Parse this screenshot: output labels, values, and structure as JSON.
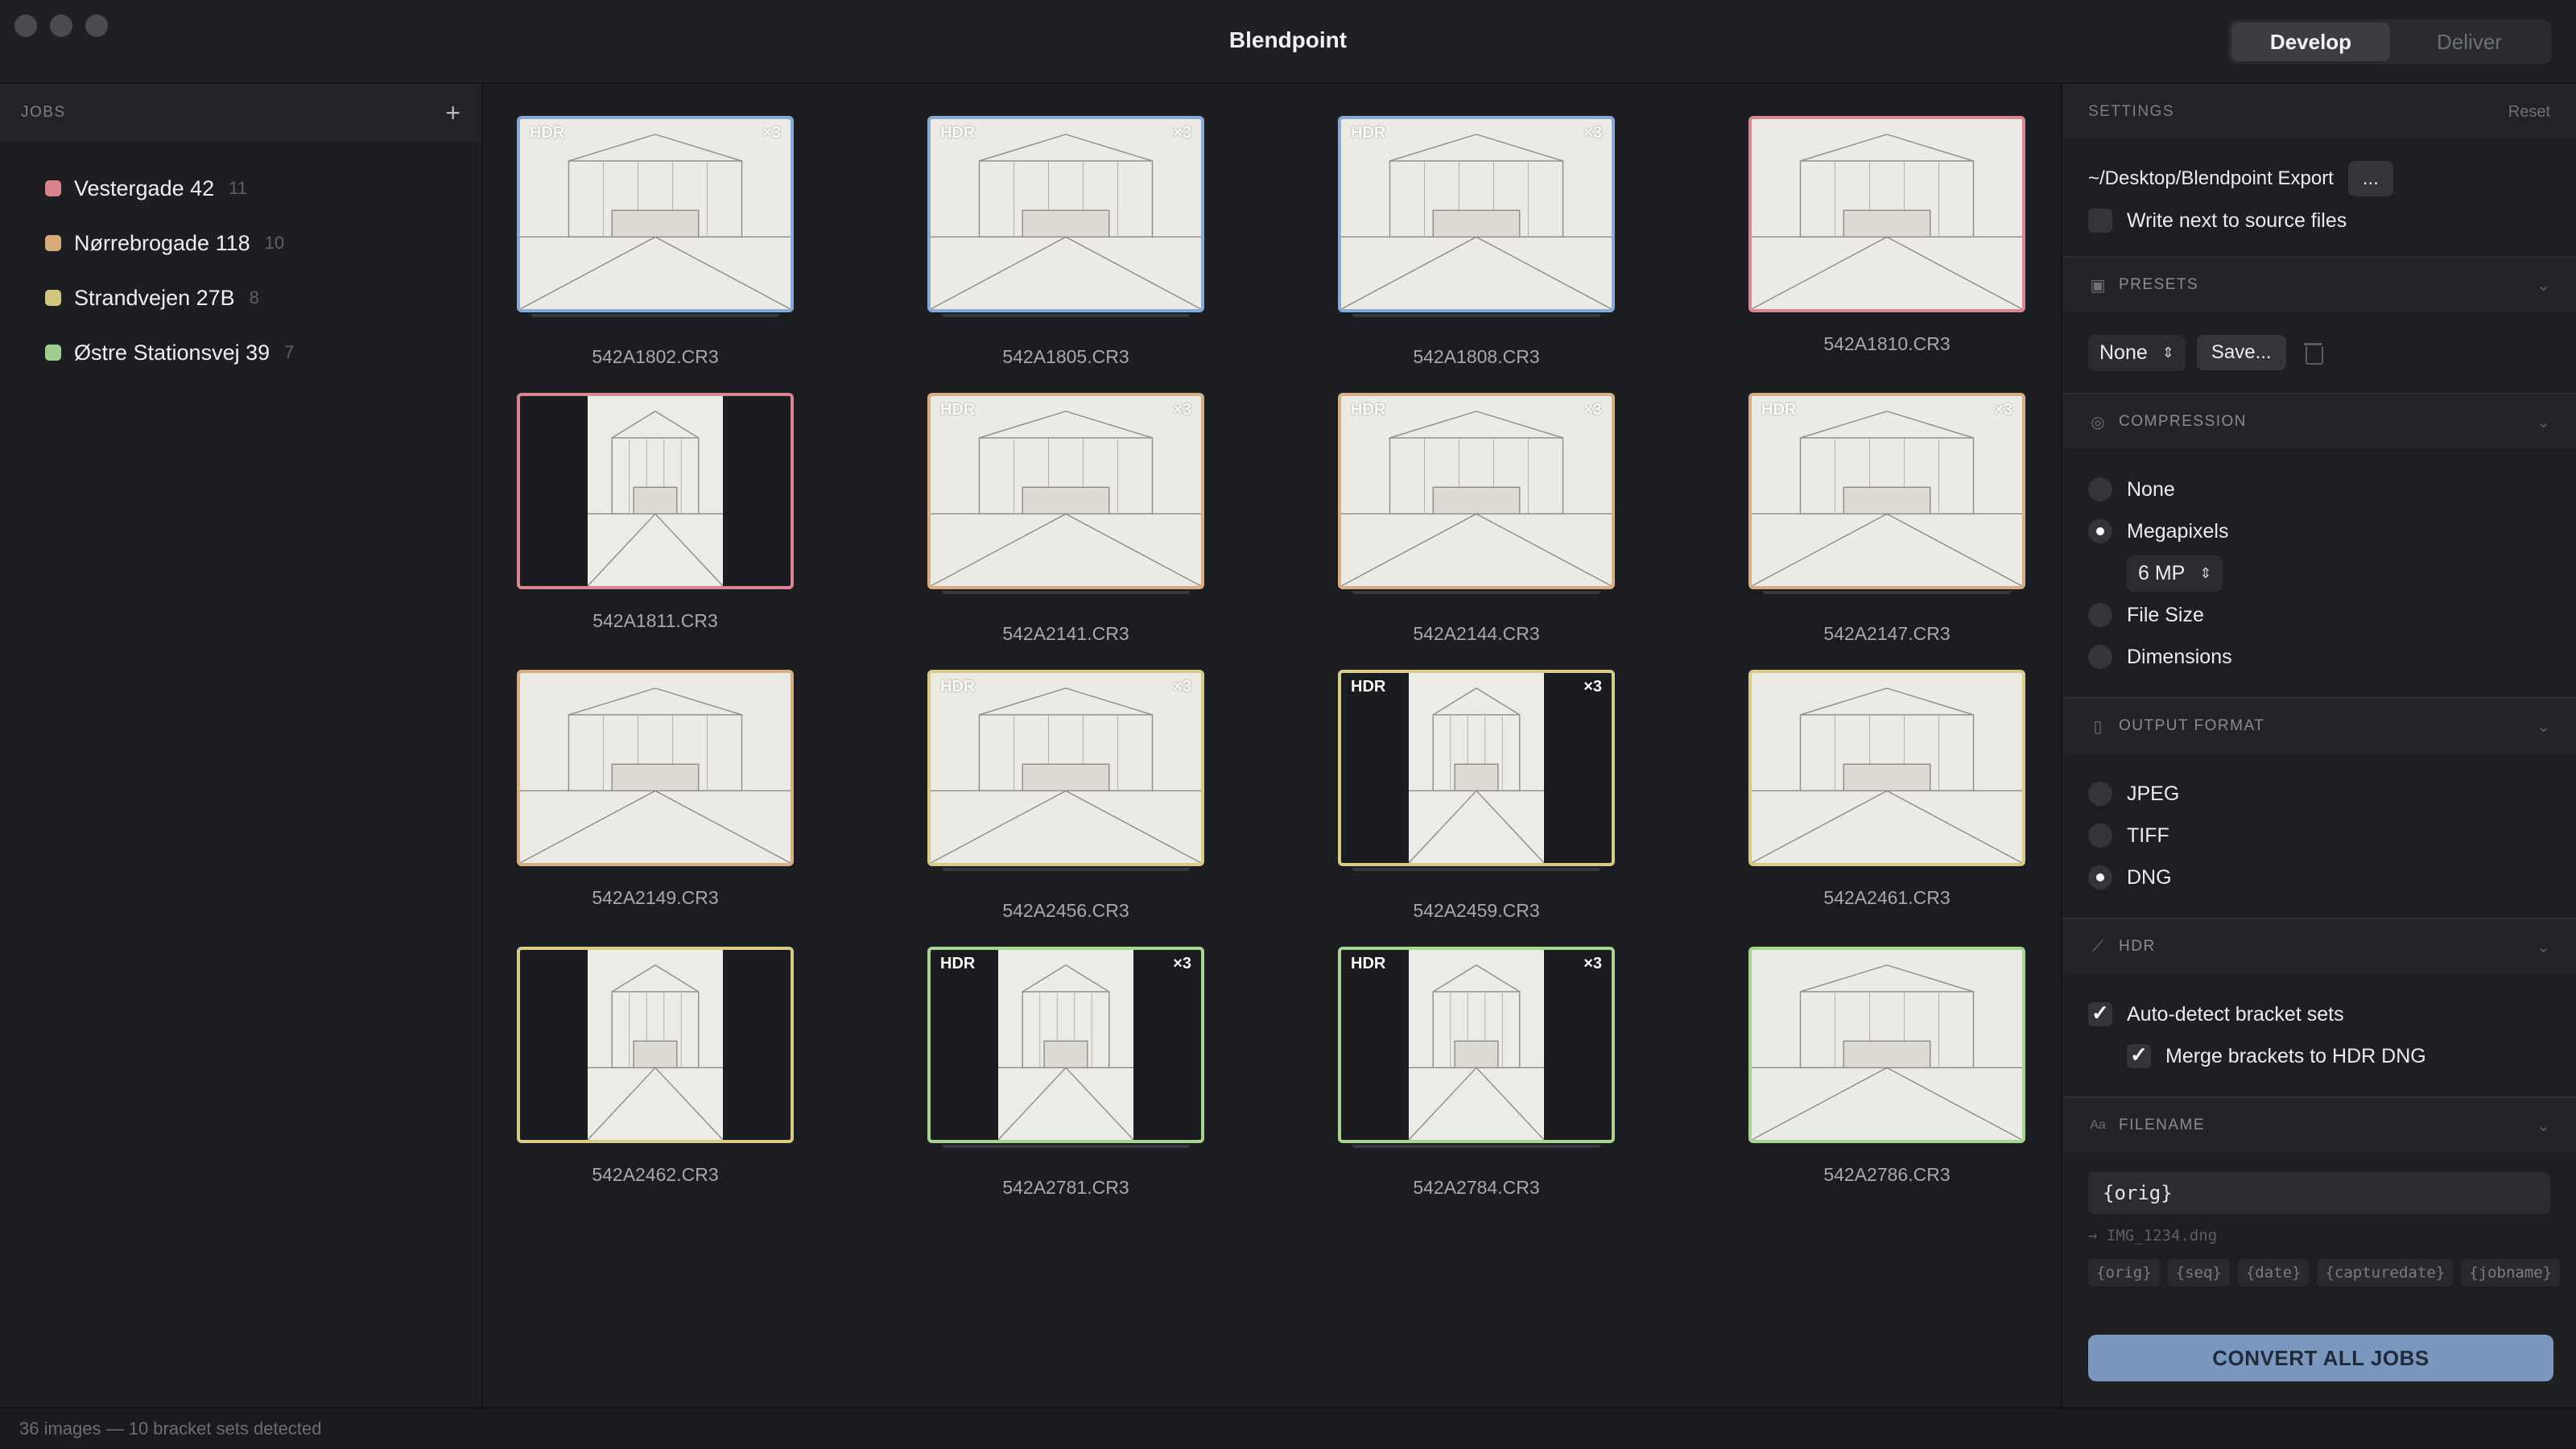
{
  "window": {
    "title": "Blendpoint",
    "modes": [
      {
        "label": "Develop",
        "active": true
      },
      {
        "label": "Deliver",
        "active": false
      }
    ]
  },
  "sidebar": {
    "header": "JOBS",
    "add_icon": "plus-icon",
    "jobs": [
      {
        "name": "Vestergade 42",
        "count": "11",
        "color": "#d9838b"
      },
      {
        "name": "Nørrebrogade 118",
        "count": "10",
        "color": "#d7a979"
      },
      {
        "name": "Strandvejen 27B",
        "count": "8",
        "color": "#d2c77f"
      },
      {
        "name": "Østre Stationsvej 39",
        "count": "7",
        "color": "#9fcf8e"
      }
    ]
  },
  "grid": {
    "tiles": [
      {
        "file": "542A1802.CR3",
        "hdr": "HDR",
        "count": "×3",
        "frame": "#86a9d8",
        "portrait": false,
        "stacked": true,
        "subject": "kitchen"
      },
      {
        "file": "542A1805.CR3",
        "hdr": "HDR",
        "count": "×3",
        "frame": "#86a9d8",
        "portrait": false,
        "stacked": true,
        "subject": "living-room"
      },
      {
        "file": "542A1808.CR3",
        "hdr": "HDR",
        "count": "×3",
        "frame": "#86a9d8",
        "portrait": false,
        "stacked": true,
        "subject": "staircase"
      },
      {
        "file": "542A1810.CR3",
        "frame": "#d98891",
        "portrait": false,
        "stacked": false,
        "subject": "pool-house"
      },
      {
        "file": "542A1811.CR3",
        "frame": "#d98891",
        "portrait": true,
        "stacked": false,
        "subject": "cube-building"
      },
      {
        "file": "542A2141.CR3",
        "hdr": "HDR",
        "count": "×3",
        "frame": "#d7ad82",
        "portrait": false,
        "stacked": true,
        "subject": "bedroom"
      },
      {
        "file": "542A2144.CR3",
        "hdr": "HDR",
        "count": "×3",
        "frame": "#d7ad82",
        "portrait": false,
        "stacked": true,
        "subject": "bathroom"
      },
      {
        "file": "542A2147.CR3",
        "hdr": "HDR",
        "count": "×3",
        "frame": "#d7ad82",
        "portrait": false,
        "stacked": true,
        "subject": "dining-room"
      },
      {
        "file": "542A2149.CR3",
        "frame": "#d7ad82",
        "portrait": false,
        "stacked": false,
        "subject": "carport"
      },
      {
        "file": "542A2456.CR3",
        "hdr": "HDR",
        "count": "×3",
        "frame": "#d7cb86",
        "portrait": false,
        "stacked": true,
        "subject": "walk-in-closet"
      },
      {
        "file": "542A2459.CR3",
        "hdr": "HDR",
        "count": "×3",
        "frame": "#d7cb86",
        "portrait": true,
        "stacked": true,
        "subject": "study"
      },
      {
        "file": "542A2461.CR3",
        "frame": "#d7cb86",
        "portrait": false,
        "stacked": false,
        "subject": "pool-terrace"
      },
      {
        "file": "542A2462.CR3",
        "frame": "#d7cb86",
        "portrait": true,
        "stacked": false,
        "subject": "aerial-villa"
      },
      {
        "file": "542A2781.CR3",
        "hdr": "HDR",
        "count": "×3",
        "frame": "#a8d48f",
        "portrait": true,
        "stacked": true,
        "subject": "stairwell"
      },
      {
        "file": "542A2784.CR3",
        "hdr": "HDR",
        "count": "×3",
        "frame": "#a8d48f",
        "portrait": true,
        "stacked": true,
        "subject": "bedroom-window"
      },
      {
        "file": "542A2786.CR3",
        "frame": "#a8d48f",
        "portrait": false,
        "stacked": false,
        "subject": "modern-villa"
      }
    ]
  },
  "settings": {
    "header": "SETTINGS",
    "reset_label": "Reset",
    "export_path": "~/Desktop/Blendpoint Export",
    "browse_label": "...",
    "write_next_label": "Write next to source files",
    "write_next_checked": false,
    "presets": {
      "header": "PRESETS",
      "selected": "None",
      "save_label": "Save..."
    },
    "compression": {
      "header": "COMPRESSION",
      "options": [
        {
          "label": "None",
          "selected": false
        },
        {
          "label": "Megapixels",
          "selected": true
        },
        {
          "label": "File Size",
          "selected": false
        },
        {
          "label": "Dimensions",
          "selected": false
        }
      ],
      "megapixels_value": "6 MP"
    },
    "output_format": {
      "header": "OUTPUT FORMAT",
      "options": [
        {
          "label": "JPEG",
          "selected": false
        },
        {
          "label": "TIFF",
          "selected": false
        },
        {
          "label": "DNG",
          "selected": true
        }
      ]
    },
    "hdr": {
      "header": "HDR",
      "auto_detect_label": "Auto-detect bracket sets",
      "auto_detect_checked": true,
      "merge_label": "Merge brackets to HDR DNG",
      "merge_checked": true
    },
    "filename": {
      "header": "FILENAME",
      "pattern": "{orig}",
      "preview": "→ IMG_1234.dng",
      "tokens": [
        "{orig}",
        "{seq}",
        "{date}",
        "{capturedate}",
        "{jobname}"
      ]
    },
    "convert_label": "CONVERT ALL JOBS"
  },
  "status": {
    "text": "36 images — 10 bracket sets detected"
  }
}
